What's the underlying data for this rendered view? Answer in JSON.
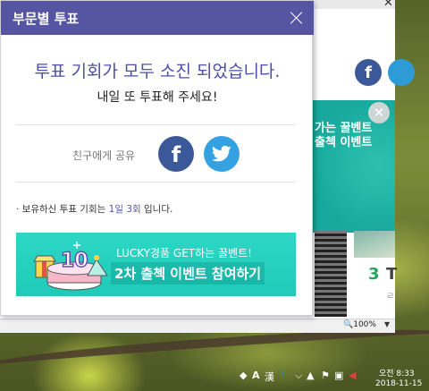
{
  "modal": {
    "title": "부문별 투표",
    "headline": "투표 기회가 모두 소진 되었습니다.",
    "subline": "내일 또 투표해 주세요!",
    "share_label": "친구에게 공유",
    "facebook_glyph": "f",
    "info_prefix": "· 보유하신 투표 기회는 ",
    "info_highlight": "1일 3회",
    "info_suffix": " 입니다.",
    "banner_line1": "LUCKY경품 GET하는 꿀벤트!",
    "banner_line2": "2차 출첵 이벤트 참여하기",
    "banner_number": "10"
  },
  "background_page": {
    "event_text": "가는 꿀벤트\n출첵 이벤트",
    "facebook_glyph": "f",
    "item_number": "3",
    "item_letter": "T",
    "item_sub": "ㄹ"
  },
  "statusbar": {
    "zoom": "100%"
  },
  "taskbar": {
    "ime_a": "A",
    "ime_han": "漢",
    "time": "오전 8:33",
    "date": "2018-11-15"
  },
  "colors": {
    "header": "#5655a1",
    "headline": "#4d4fa8",
    "facebook": "#3b5998",
    "twitter": "#34a2e0",
    "banner": "#2dd7c5"
  }
}
